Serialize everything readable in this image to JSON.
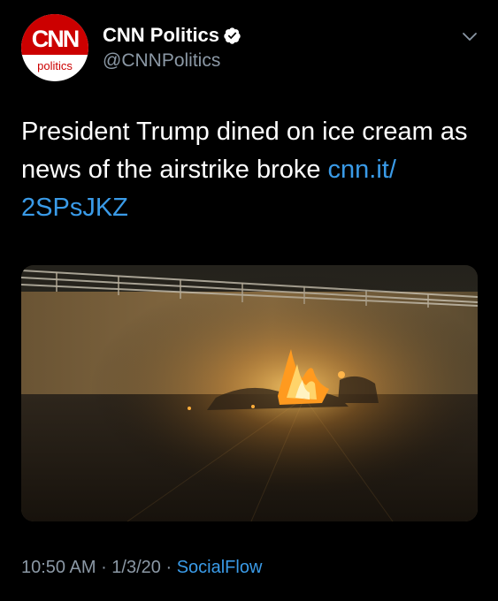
{
  "author": {
    "display_name": "CNN Politics",
    "handle": "@CNNPolitics",
    "verified": true,
    "avatar": {
      "logo_text": "CNN",
      "sub_text": "politics",
      "brand_color": "#cc0000"
    }
  },
  "tweet": {
    "text": "President Trump dined on ice cream as news of the airstrike broke ",
    "link_text": "cnn.it/ 2SPsJKZ",
    "media": {
      "description_icon": "photo-image"
    }
  },
  "meta": {
    "time": "10:50 AM",
    "separator_1": " · ",
    "date": "1/3/20",
    "separator_2": " · ",
    "source": "SocialFlow"
  },
  "colors": {
    "background": "#000000",
    "text": "#ffffff",
    "secondary": "#8b98a5",
    "link": "#3a9be8",
    "verified": "#ffffff"
  },
  "icons": {
    "verified": "verified-badge-icon",
    "more": "chevron-down-icon"
  }
}
